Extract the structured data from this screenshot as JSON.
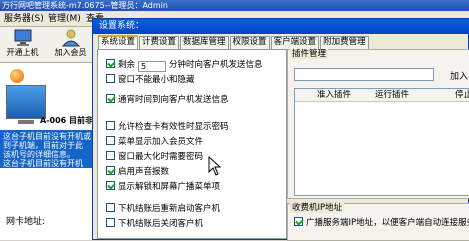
{
  "app": {
    "title": "万行网吧管理系统-m7.0675--管理员：Admin"
  },
  "menu": [
    "服务器(S)",
    "管理(M)",
    "查看"
  ],
  "toolbar": {
    "items": [
      {
        "label": "开通上机",
        "icon": "computer-icon"
      },
      {
        "label": "加入会员",
        "icon": "add-member-icon"
      }
    ]
  },
  "left_panel": {
    "pc_name": "A-006 目前非",
    "warning_lines": [
      "这台子机目前没有开机或",
      "到子机端，目前对于此",
      "该机号的详细信息。",
      "这台子机目前没有开机"
    ],
    "mac_label": "网卡地址:"
  },
  "dialog": {
    "title": "设置系统：",
    "tabs": [
      "系统设置",
      "计费设置",
      "数据库管理",
      "权限设置",
      "客户端设置",
      "附加费管理"
    ],
    "active_tab": 0,
    "settings": [
      {
        "label_pre": "剩余",
        "value": "5",
        "label_post": "分钟时向客户机发送信息",
        "checked": true
      },
      {
        "label": "窗口不能最小和隐藏",
        "checked": false
      },
      {
        "label": "通宵时间到向客户机发送信息",
        "checked": true
      },
      {
        "label": "允许检查卡有效性时显示密码",
        "checked": false
      },
      {
        "label": "菜单显示加入会员文件",
        "checked": false
      },
      {
        "label": "窗口最大化时需要密码",
        "checked": false
      },
      {
        "label": "启用声音报数",
        "checked": true
      },
      {
        "label": "显示解锁和屏幕广播菜单项",
        "checked": true
      },
      {
        "label": "下机结账后重新启动客户机",
        "checked": false
      },
      {
        "label": "下机结账后关闭客户机",
        "checked": false
      }
    ],
    "plugin_group": {
      "title": "插件管理",
      "input_value": "",
      "add_label": "加入",
      "columns": [
        "准入插件",
        "运行插件",
        "停止"
      ]
    },
    "ip_group": {
      "title": "收费机IP地址",
      "checkbox_label": "广播服务端IP地址，以便客户端自动连接服务",
      "checked": true
    }
  },
  "colors": {
    "title_bar": "#2150b0",
    "warn_bg": "#1565c8",
    "check_color": "#21a121"
  }
}
